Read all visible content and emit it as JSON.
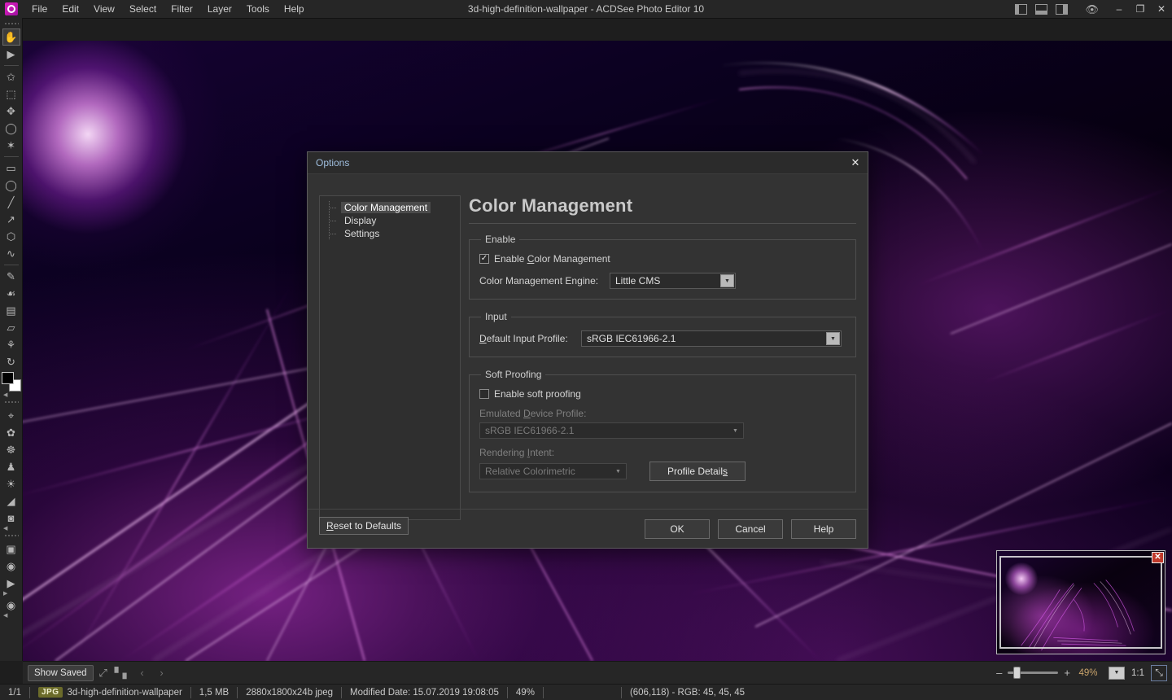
{
  "window": {
    "title": "3d-high-definition-wallpaper - ACDSee Photo Editor 10",
    "app_logo": "acdsee-logo-icon",
    "menus": [
      "File",
      "Edit",
      "View",
      "Select",
      "Filter",
      "Layer",
      "Tools",
      "Help"
    ],
    "pane_toggles": [
      "left-pane-icon",
      "bottom-pane-icon",
      "right-pane-icon"
    ],
    "preview_icon": "eye-preview-icon",
    "controls": {
      "minimize": "–",
      "restore": "❐",
      "close": "✕"
    }
  },
  "toolbar": {
    "tools": [
      {
        "name": "pan-hand-tool",
        "glyph": "✋",
        "selected": true
      },
      {
        "name": "move-selection-tool",
        "glyph": "▶"
      },
      {
        "sep": true
      },
      {
        "name": "magic-wand-select-tool",
        "glyph": "✄"
      },
      {
        "name": "marquee-nodes-tool",
        "glyph": "⬚"
      },
      {
        "name": "polygon-select-tool",
        "glyph": "✥"
      },
      {
        "name": "lasso-tool",
        "glyph": "◯"
      },
      {
        "name": "magic-select-tool",
        "glyph": "✦"
      },
      {
        "sep": true
      },
      {
        "name": "rectangle-shape-tool",
        "glyph": "▭"
      },
      {
        "name": "ellipse-shape-tool",
        "glyph": "◯"
      },
      {
        "name": "line-tool",
        "glyph": "╱"
      },
      {
        "name": "arrow-tool",
        "glyph": "↗"
      },
      {
        "name": "polygon-tool",
        "glyph": "⬡"
      },
      {
        "name": "curve-tool",
        "glyph": "∿"
      },
      {
        "sep": true
      },
      {
        "name": "brush-tool",
        "glyph": "✎"
      },
      {
        "name": "clone-stamp-tool",
        "glyph": "☙"
      },
      {
        "name": "gradient-tool",
        "glyph": "▤"
      },
      {
        "name": "eraser-tool",
        "glyph": "▱"
      },
      {
        "name": "eyedropper-tool",
        "glyph": "☂"
      },
      {
        "name": "swap-colors-tool",
        "glyph": "↻"
      }
    ],
    "foreground_color": "#000000",
    "background_color": "#ffffff",
    "tools_bottom": [
      {
        "name": "red-eye-tool",
        "glyph": "⌖"
      },
      {
        "name": "blemish-remover-tool",
        "glyph": "❀"
      },
      {
        "name": "repair-tool",
        "glyph": "☸"
      },
      {
        "name": "dodge-burn-tool",
        "glyph": "♟"
      },
      {
        "name": "light-eq-tool",
        "glyph": "☀"
      },
      {
        "name": "paint-bucket-tool",
        "glyph": "◢"
      },
      {
        "name": "blur-tool",
        "glyph": "⚫"
      },
      {
        "sep": true
      },
      {
        "name": "fill-square-tool",
        "glyph": "■"
      },
      {
        "name": "fill-circle-tool",
        "glyph": "●"
      },
      {
        "name": "play-shape-tool",
        "glyph": "▶"
      },
      {
        "name": "play-button-tool",
        "glyph": "▶"
      }
    ]
  },
  "navigator": {
    "name": "navigator-panel",
    "close_label": "✕"
  },
  "filmbar": {
    "show_saved_label": "Show Saved",
    "fullscreen_icon": "fullscreen-icon",
    "histogram_icon": "histogram-icon",
    "prev_icon": "‹",
    "next_icon": "›",
    "zoom_out": "–",
    "zoom_in": "+",
    "zoom_percent": "49%",
    "zoom_dropdown_icon": "chevron-down-icon",
    "ratio_label": "1:1",
    "fit_icon": "⤡"
  },
  "statusbar": {
    "page": "1/1",
    "format_badge": "JPG",
    "filename": "3d-high-definition-wallpaper",
    "filesize": "1,5 MB",
    "dimensions": "2880x1800x24b jpeg",
    "modified": "Modified Date: 15.07.2019 19:08:05",
    "zoom": "49%",
    "cursor_info": "(606,118) - RGB: 45, 45, 45"
  },
  "dialog": {
    "title": "Options",
    "close_label": "✕",
    "tree": [
      {
        "label": "Color Management",
        "selected": true
      },
      {
        "label": "Display",
        "selected": false
      },
      {
        "label": "Settings",
        "selected": false
      }
    ],
    "page_title": "Color Management",
    "enable_group": {
      "legend": "Enable",
      "checkbox_label": "Enable Color Management",
      "checkbox_checked": true,
      "checkbox_mark": "✓",
      "engine_label": "Color Management Engine:",
      "engine_value": "Little CMS"
    },
    "input_group": {
      "legend": "Input",
      "profile_label": "Default Input Profile:",
      "profile_value": "sRGB IEC61966-2.1"
    },
    "softproof_group": {
      "legend": "Soft Proofing",
      "checkbox_label": "Enable soft proofing",
      "checkbox_checked": false,
      "device_label": "Emulated Device Profile:",
      "device_value": "sRGB IEC61966-2.1",
      "intent_label": "Rendering Intent:",
      "intent_value": "Relative Colorimetric",
      "profile_details_label": "Profile Details"
    },
    "footer": {
      "reset_label": "Reset to Defaults",
      "ok_label": "OK",
      "cancel_label": "Cancel",
      "help_label": "Help"
    }
  }
}
